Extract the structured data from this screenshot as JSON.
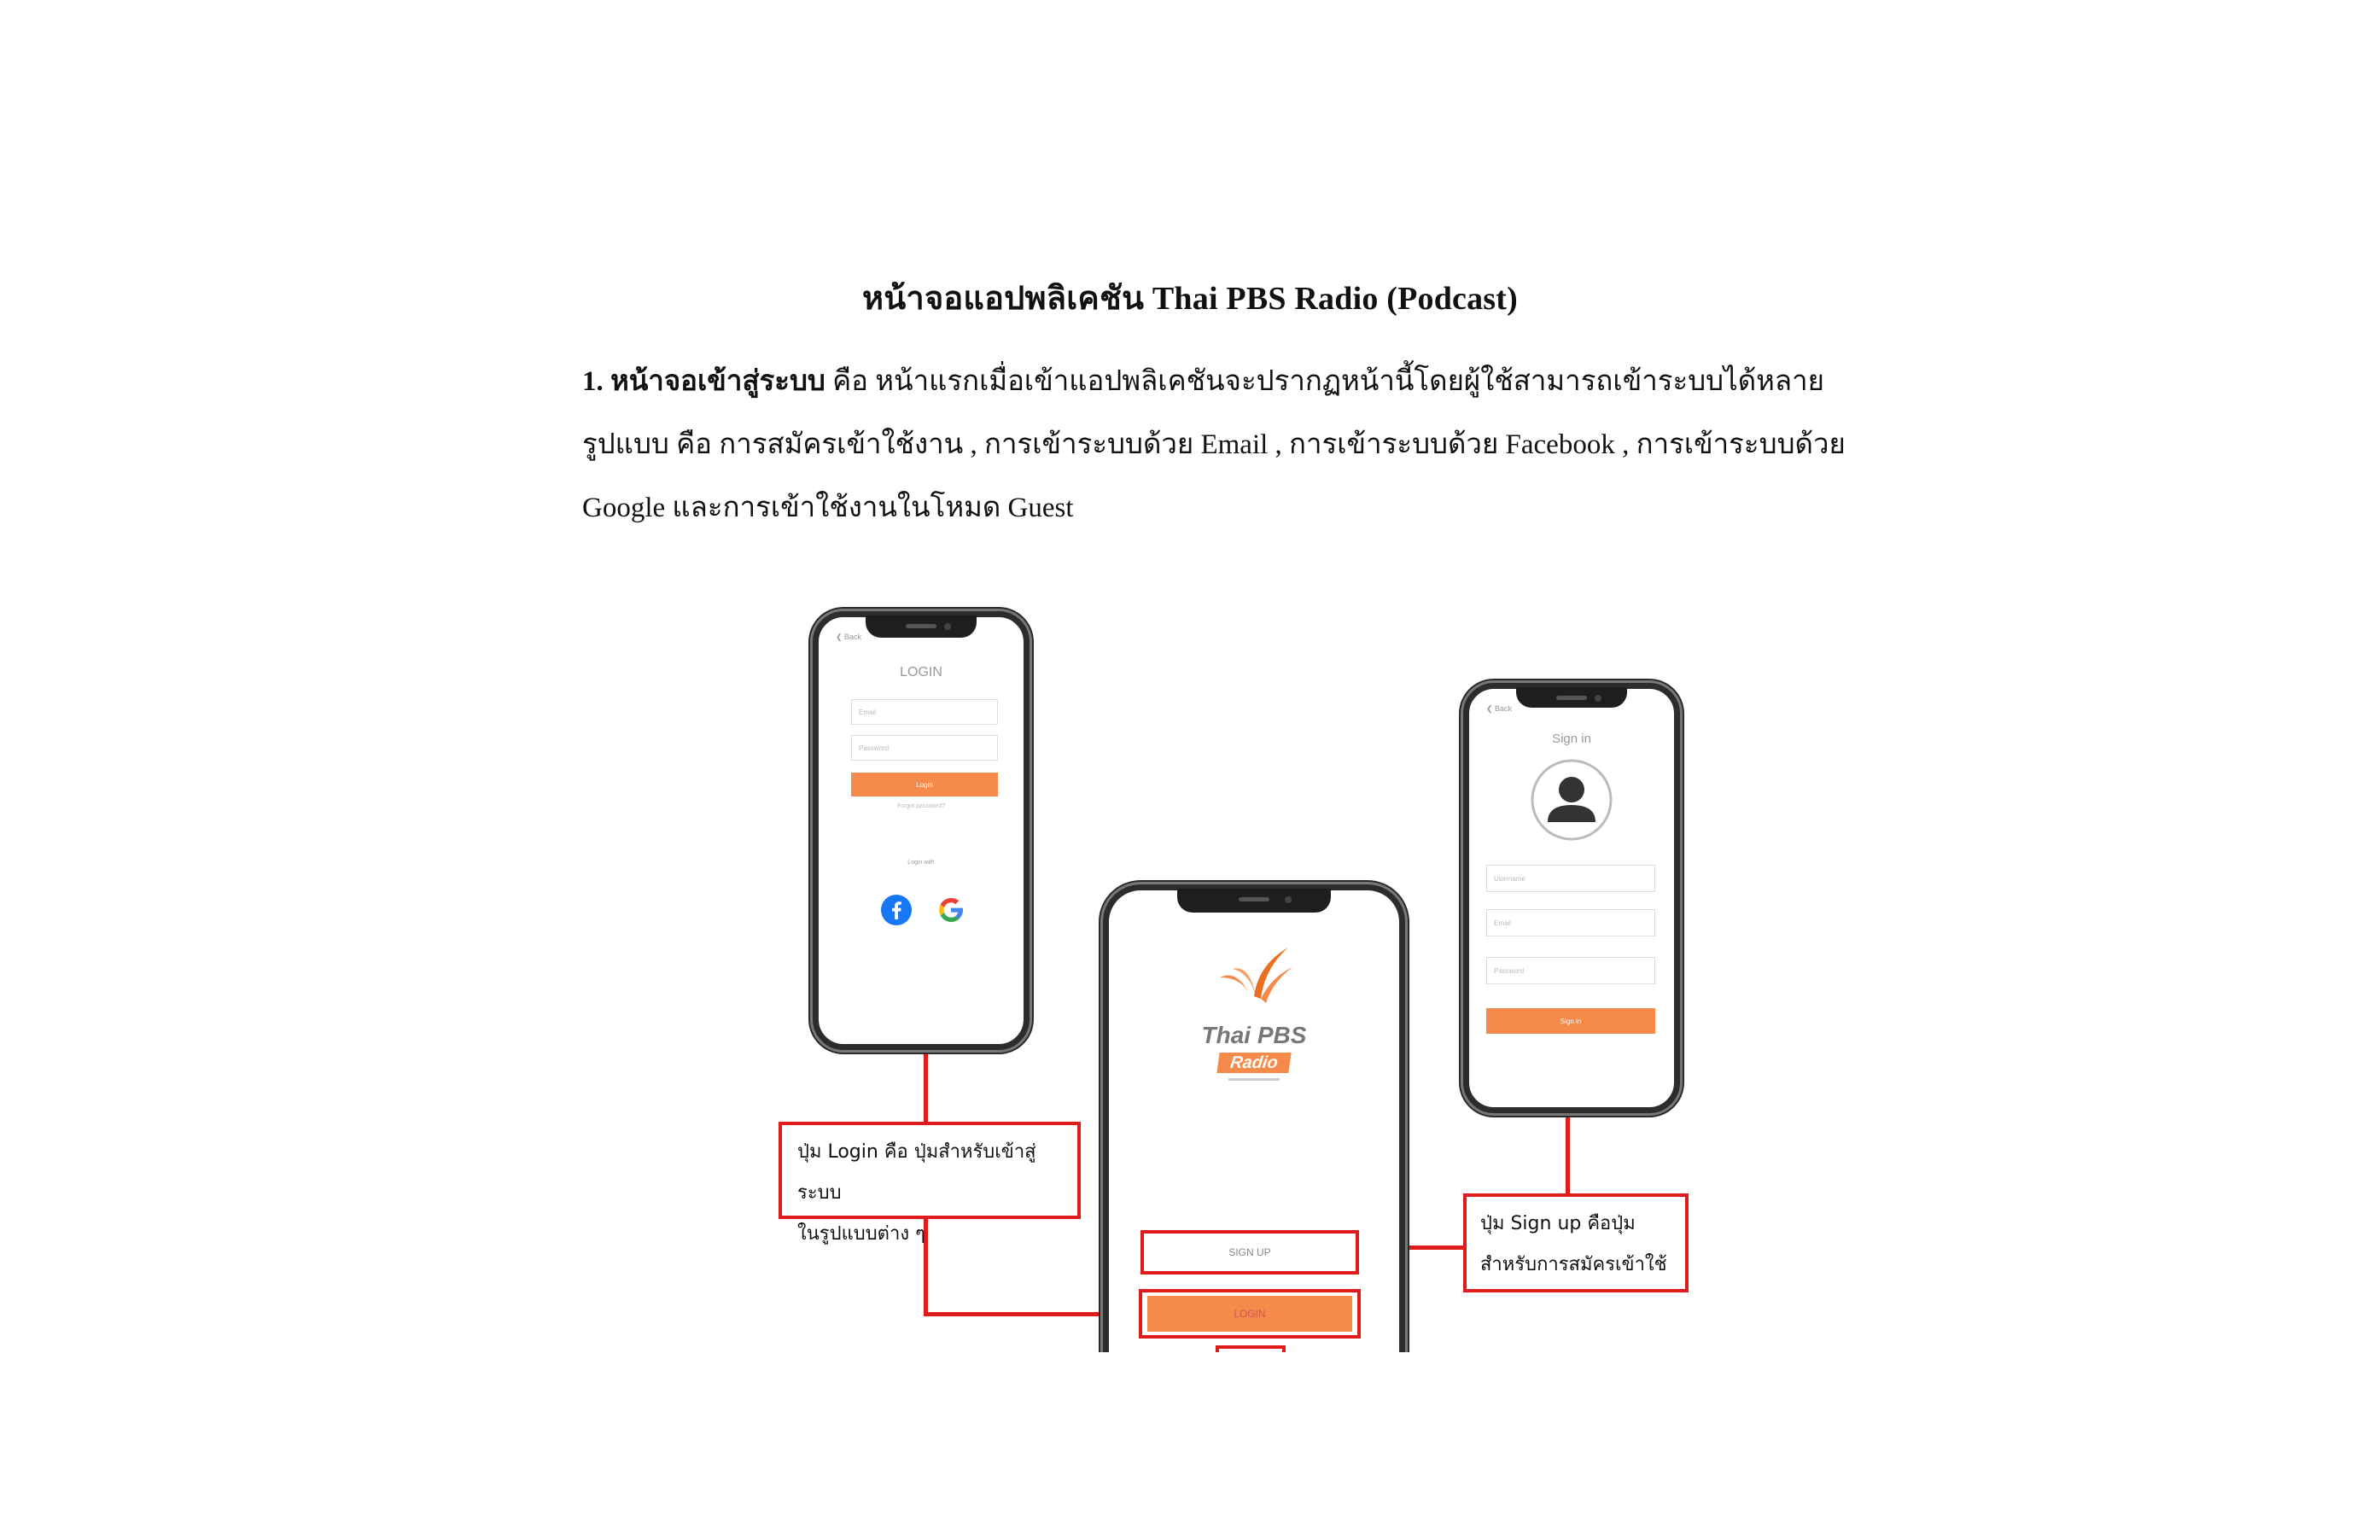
{
  "document": {
    "title": "หน้าจอแอปพลิเคชัน Thai PBS Radio (Podcast)",
    "paragraph": {
      "heading": "1. หน้าจอเข้าสู่ระบบ",
      "line1_rest": " คือ หน้าแรกเมื่อเข้าแอปพลิเคชันจะปรากฏหน้านี้โดยผู้ใช้สามารถเข้าระบบได้หลาย",
      "line2": "รูปแบบ คือ การสมัครเข้าใช้งาน , การเข้าระบบด้วย Email , การเข้าระบบด้วย Facebook , การเข้าระบบด้วย",
      "line3": "Google และการเข้าใช้งานในโหมด Guest"
    }
  },
  "login_phone": {
    "back": "❮ Back",
    "title": "LOGIN",
    "email_placeholder": "Email",
    "password_placeholder": "Password",
    "login_button": "Login",
    "forgot": "Forgot password?",
    "login_with": "Login with",
    "facebook_icon": "facebook-icon",
    "google_icon": "google-icon"
  },
  "center_phone": {
    "brand_line1": "Thai PBS",
    "brand_line2": "Radio",
    "signup_button": "SIGN UP",
    "login_button": "LOGIN"
  },
  "signin_phone": {
    "back": "❮ Back",
    "title": "Sign in",
    "avatar_icon": "user-avatar-icon",
    "username_placeholder": "Username",
    "email_placeholder": "Email",
    "password_placeholder": "Password",
    "signin_button": "Sign in"
  },
  "callouts": {
    "login": {
      "line1": "ปุ่ม Login คือ ปุ่มสำหรับเข้าสู่ระบบ",
      "line2": "ในรูปแบบต่าง ๆ"
    },
    "signup": {
      "line1": "ปุ่ม Sign up คือปุ่ม",
      "line2": "สำหรับการสมัครเข้าใช้"
    }
  },
  "colors": {
    "accent_orange": "#f58a4a",
    "callout_red": "#e01b1b"
  }
}
